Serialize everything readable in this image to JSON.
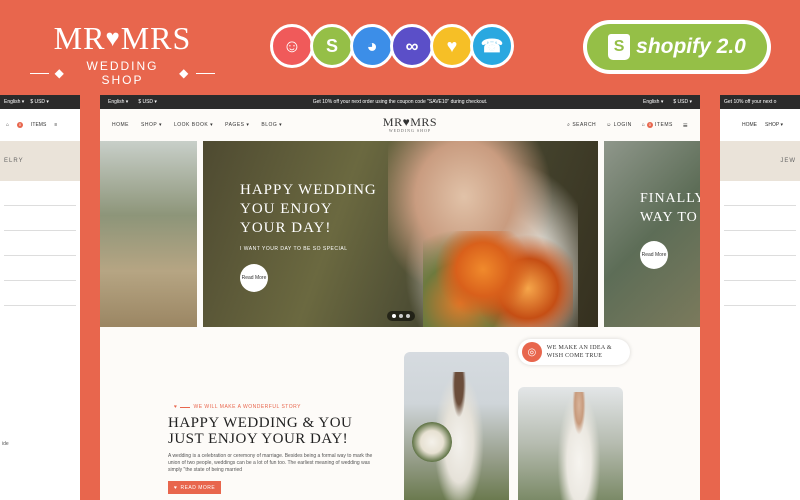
{
  "brand": {
    "logo_left": "MR",
    "logo_right": "MRS",
    "tagline": "WEDDING SHOP"
  },
  "badges": [
    {
      "icon": "cat-mascot-icon",
      "color": "#f05a5a"
    },
    {
      "icon": "shopify-bag-icon",
      "color": "#95bf47"
    },
    {
      "icon": "owl-mascot-icon",
      "color": "#3c8ee8"
    },
    {
      "icon": "infinity-knot-icon",
      "color": "#5b4fc8"
    },
    {
      "icon": "eye-heart-icon",
      "color": "#f6bf26"
    },
    {
      "icon": "support-agent-icon",
      "color": "#2aa8e0"
    }
  ],
  "shopify": {
    "label": "shopify 2.0"
  },
  "topbar": {
    "language": "English ▾",
    "currency": "$ USD ▾",
    "message": "Get 10% off your next order using the coupon code \"SAVE10\" during checkout.",
    "right_message": "Get 10% off your next o"
  },
  "nav": {
    "links": [
      "HOME",
      "SHOP ▾",
      "LOOK BOOK ▾",
      "PAGES ▾",
      "BLOG ▾"
    ],
    "logo": "MR♥MRS",
    "logo_sub": "WEDDING SHOP",
    "search": "SEARCH",
    "login": "LOGIN",
    "cart_count": "0",
    "cart": "ITEMS"
  },
  "peek_left": {
    "cart_count": "0",
    "cart": "ITEMS",
    "strip": "ELRY",
    "footer": "ide"
  },
  "peek_right": {
    "links": [
      "HOME",
      "SHOP ▾"
    ],
    "strip": "JEW"
  },
  "hero": {
    "title": "HAPPY WEDDING YOU ENJOY YOUR DAY!",
    "subtitle": "I WANT YOUR DAY TO BE SO SPECIAL",
    "button": "Read More",
    "right_title": "FINALLY WAY TO",
    "right_button": "Read More",
    "dot_count": 3,
    "active_dot": 0
  },
  "about": {
    "eyebrow": "WE WILL MAKE A WONDERFUL STORY",
    "title": "HAPPY WEDDING & YOU JUST ENJOY YOUR DAY!",
    "body": "A wedding is a celebration or ceremony of marriage. Besides being a formal way to mark the union of two people, weddings can be a lot of fun too. The earliest meaning of wedding was simply \"the state of being married",
    "button": "READ MORE",
    "idea": "WE MAKE AN IDEA & WISH COME TRUE"
  }
}
